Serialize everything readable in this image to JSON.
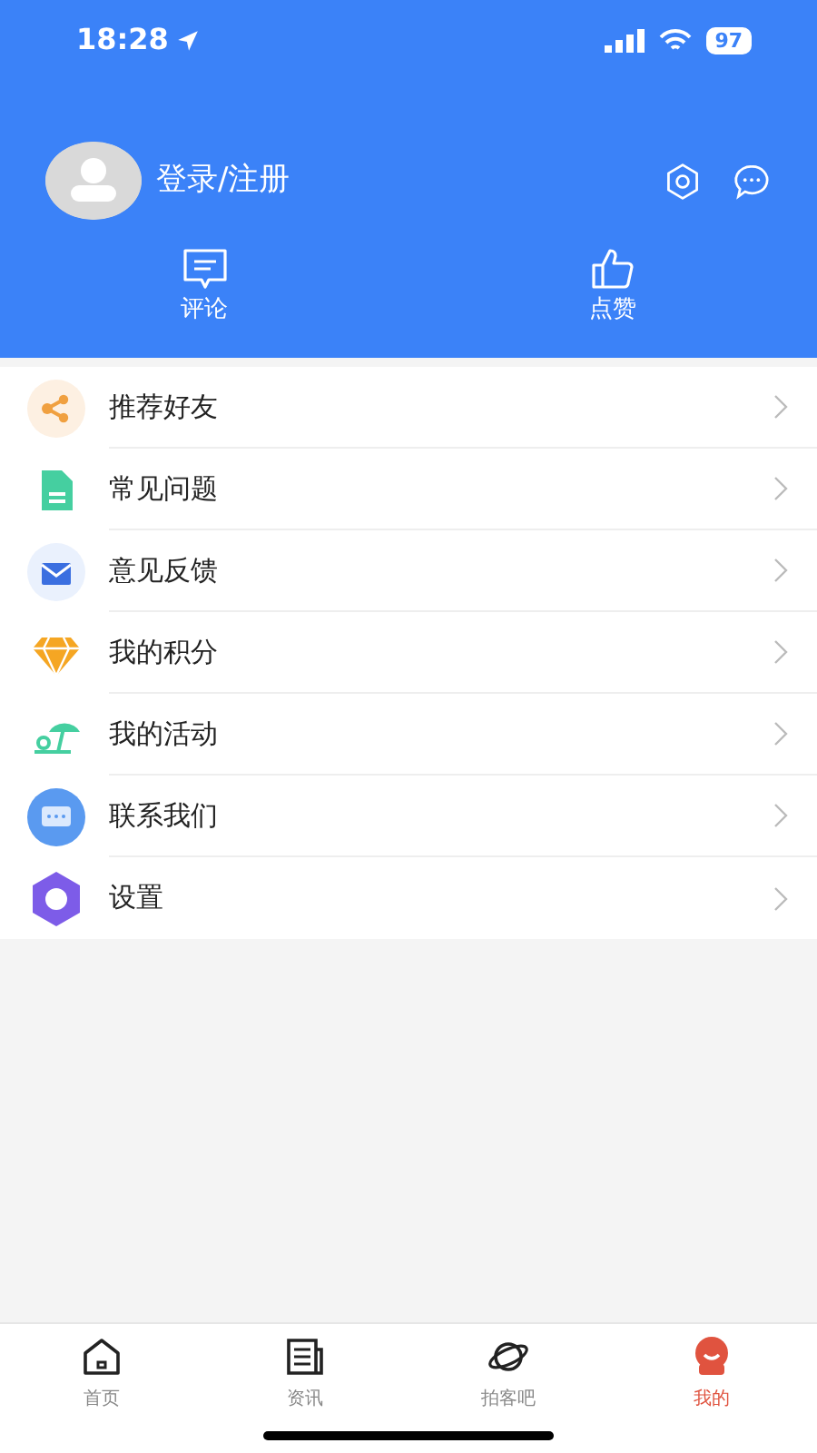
{
  "status_bar": {
    "time": "18:28",
    "battery": "97"
  },
  "profile": {
    "login_label": "登录/注册"
  },
  "actions": [
    {
      "kind": "comment",
      "label": "评论"
    },
    {
      "kind": "like",
      "label": "点赞"
    }
  ],
  "menu": [
    {
      "kind": "share",
      "label": "推荐好友"
    },
    {
      "kind": "document",
      "label": "常见问题"
    },
    {
      "kind": "mail",
      "label": "意见反馈"
    },
    {
      "kind": "diamond",
      "label": "我的积分"
    },
    {
      "kind": "activity",
      "label": "我的活动"
    },
    {
      "kind": "contact",
      "label": "联系我们"
    },
    {
      "kind": "settings",
      "label": "设置"
    }
  ],
  "tab_bar": [
    {
      "kind": "home",
      "label": "首页",
      "selected": false
    },
    {
      "kind": "news",
      "label": "资讯",
      "selected": false
    },
    {
      "kind": "planet",
      "label": "拍客吧",
      "selected": false
    },
    {
      "kind": "mine",
      "label": "我的",
      "selected": true
    }
  ]
}
